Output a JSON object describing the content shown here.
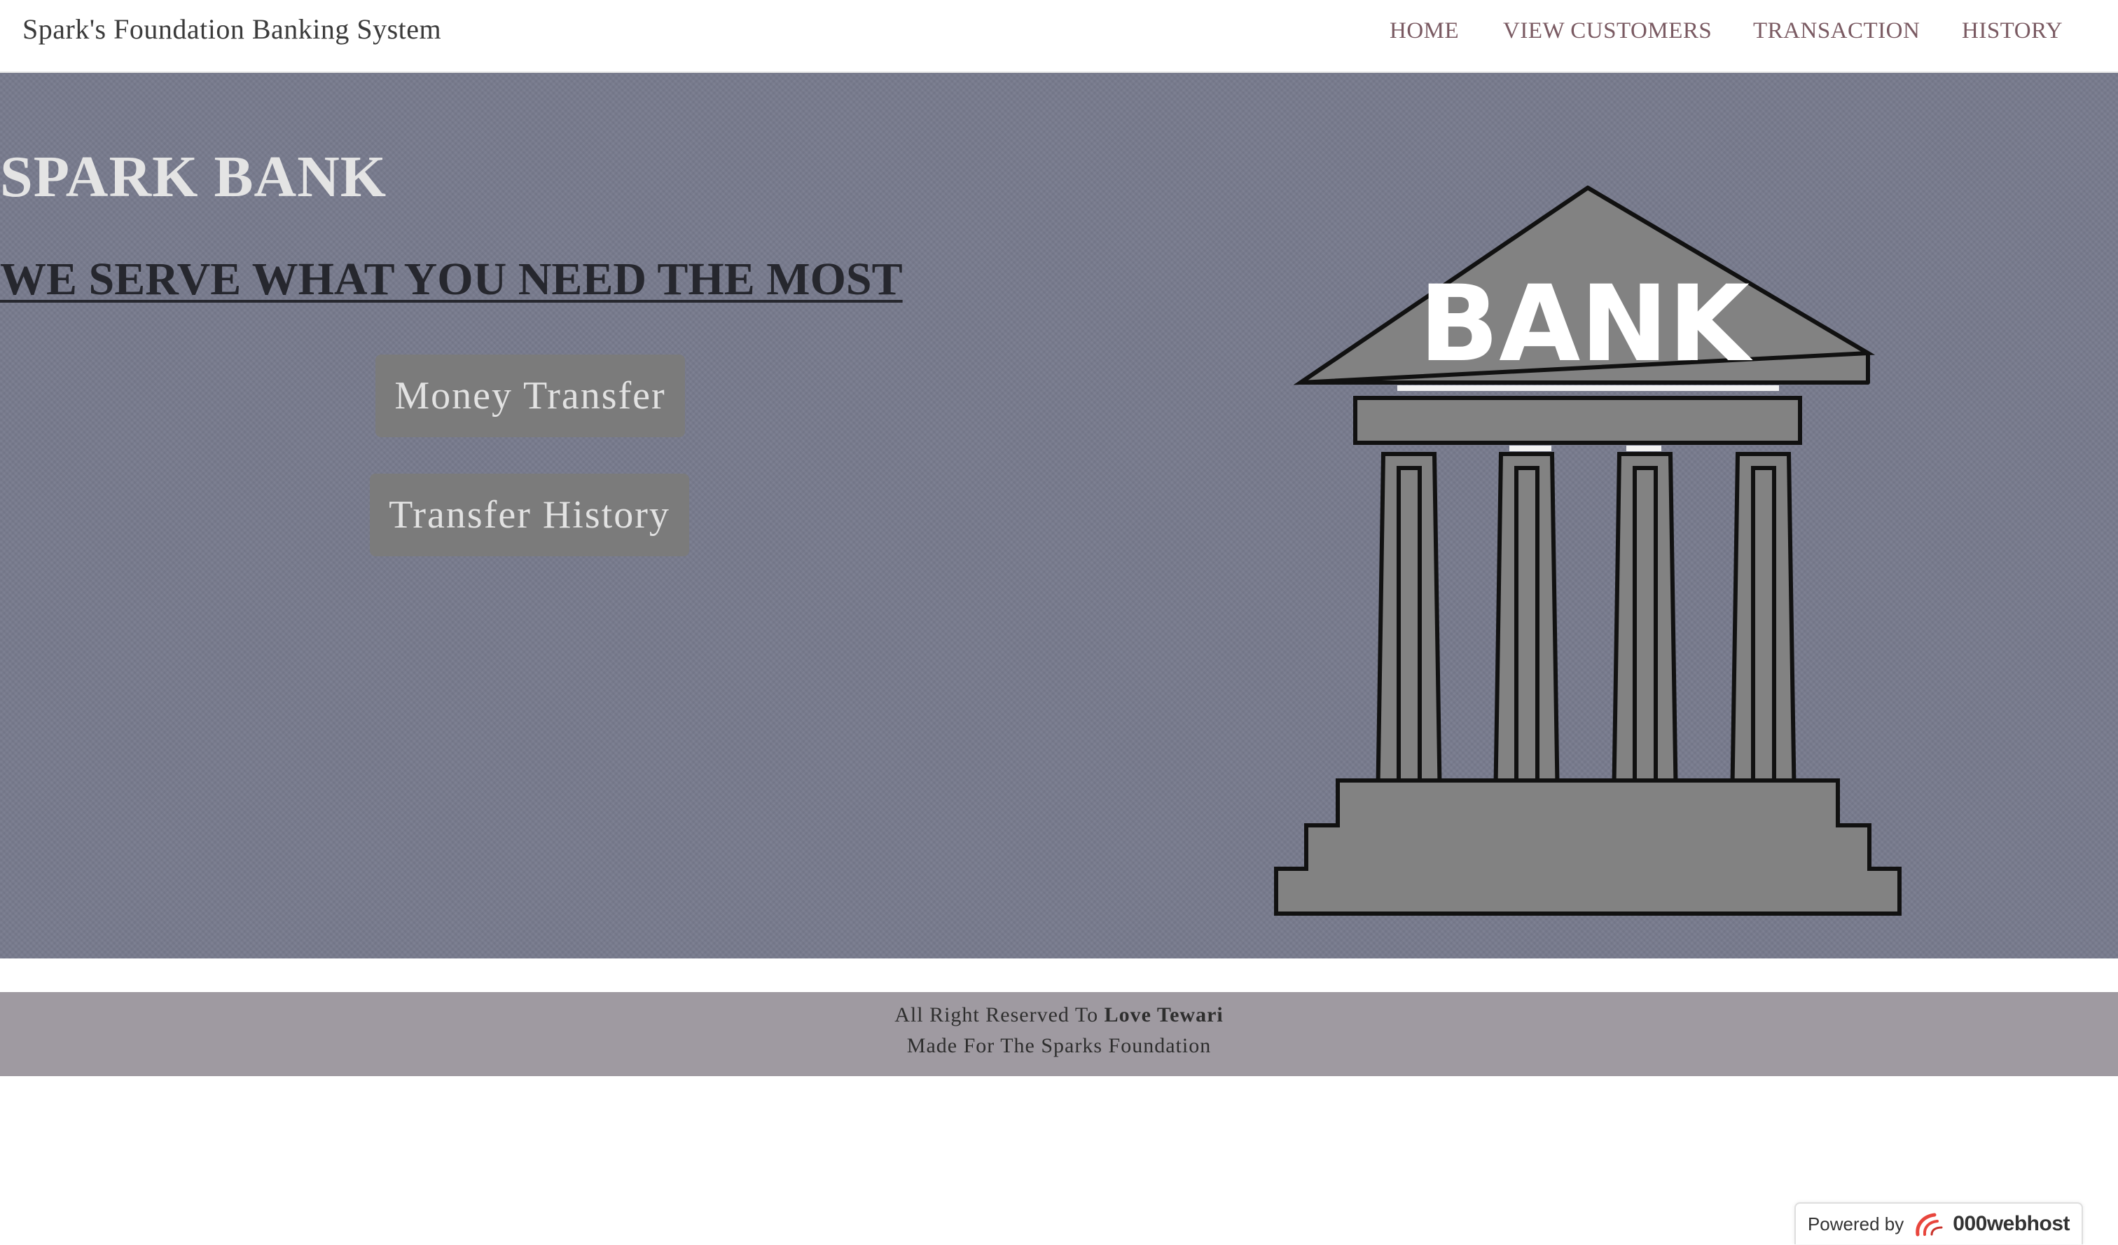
{
  "navbar": {
    "brand": "Spark's Foundation Banking System",
    "links": [
      {
        "label": "HOME"
      },
      {
        "label": "VIEW CUSTOMERS"
      },
      {
        "label": "TRANSACTION"
      },
      {
        "label": "HISTORY"
      }
    ]
  },
  "hero": {
    "title": "SPARK BANK",
    "tagline": "WE SERVE WHAT YOU NEED THE MOST",
    "buttons": [
      {
        "label": "Money Transfer"
      },
      {
        "label": "Transfer History"
      }
    ],
    "illustration_text": "BANK"
  },
  "footer": {
    "line1_prefix": "All Right Reserved To ",
    "line1_name": "Love Tewari",
    "line2": "Made For The Sparks Foundation"
  },
  "badge": {
    "prefix": "Powered by",
    "host": "000webhost"
  },
  "colors": {
    "hero_background": "#777a8d",
    "footer_background": "#9f9aa1",
    "nav_link": "#7a5a62",
    "button_background": "#7b7b7b"
  }
}
